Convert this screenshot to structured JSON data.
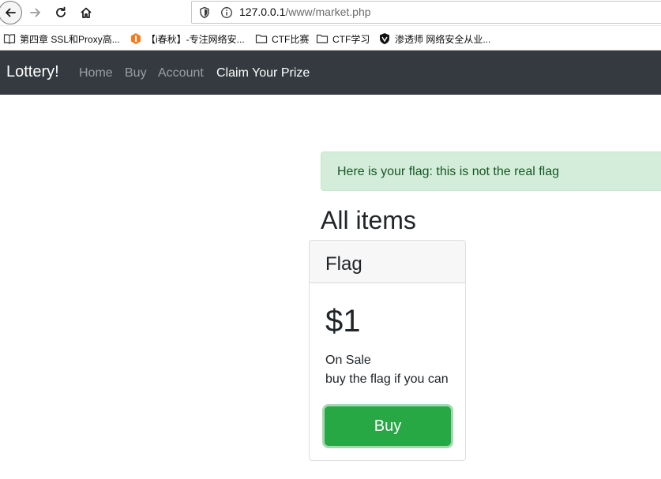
{
  "browser": {
    "url_host": "127.0.0.1",
    "url_path": "/www/market.php",
    "bookmarks": [
      {
        "label": "第四章 SSL和Proxy高...",
        "icon": "book-icon"
      },
      {
        "label": "【i春秋】-专注网络安...",
        "icon": "ichunqiu-logo-icon"
      },
      {
        "label": "CTF比赛",
        "icon": "folder-icon"
      },
      {
        "label": "CTF学习",
        "icon": "folder-icon"
      },
      {
        "label": "渗透师 网络安全从业...",
        "icon": "shield-logo-icon"
      }
    ]
  },
  "navbar": {
    "brand": "Lottery!",
    "links": [
      "Home",
      "Buy",
      "Account",
      "Claim Your Prize"
    ],
    "active_link": "Claim Your Prize",
    "background": "#343a40"
  },
  "alert": {
    "message": "Here is your flag: this is not the real flag",
    "background": "#d4edda",
    "color": "#155724"
  },
  "main": {
    "section_title": "All items",
    "items": [
      {
        "name": "Flag",
        "price": "$1",
        "status": "On Sale",
        "description": "buy the flag if you can",
        "button_label": "Buy",
        "button_color": "#28a745"
      }
    ]
  }
}
